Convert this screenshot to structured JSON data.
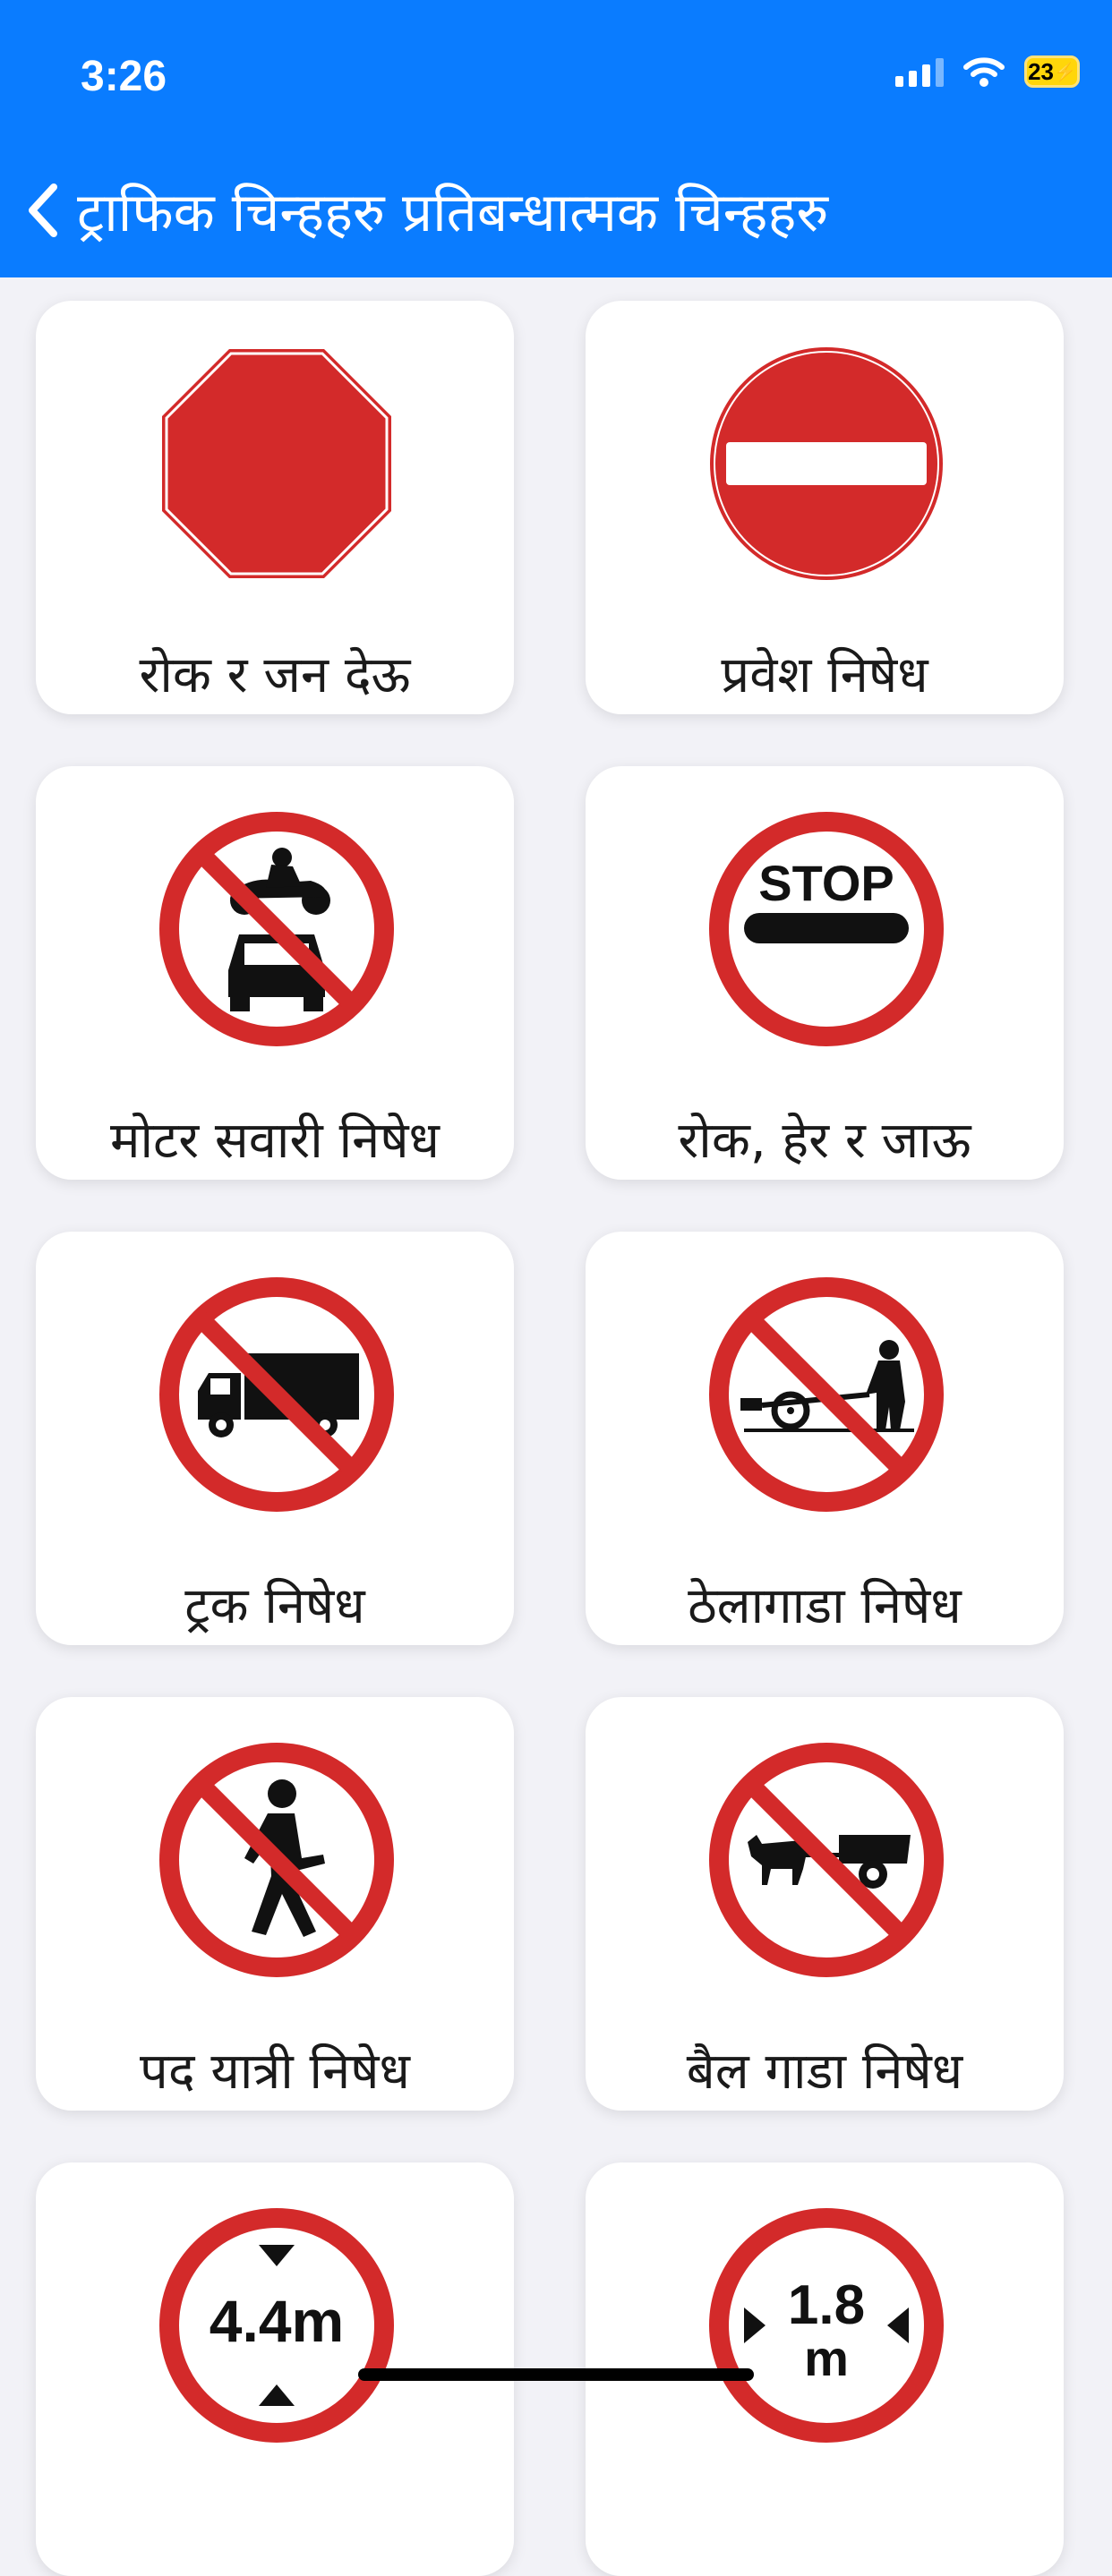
{
  "status": {
    "time": "3:26",
    "battery": "23"
  },
  "nav": {
    "title": "ट्राफिक चिन्हहरु प्रतिबन्धात्मक चिन्हहरु",
    "back_icon": "chevron-left-icon"
  },
  "signs": [
    {
      "label": "रोक र जन देऊ",
      "icon": "stop-octagon-icon"
    },
    {
      "label": "प्रवेश निषेध",
      "icon": "no-entry-icon"
    },
    {
      "label": "मोटर सवारी निषेध",
      "icon": "no-motor-vehicles-icon"
    },
    {
      "label": "रोक, हेर र जाऊ",
      "icon": "stop-look-go-icon",
      "sign_text": "STOP"
    },
    {
      "label": "ट्रक निषेध",
      "icon": "no-trucks-icon"
    },
    {
      "label": "ठेलागाडा निषेध",
      "icon": "no-handcarts-icon"
    },
    {
      "label": "पद यात्री निषेध",
      "icon": "no-pedestrians-icon"
    },
    {
      "label": "बैल गाडा निषेध",
      "icon": "no-bullock-carts-icon"
    },
    {
      "label": "",
      "icon": "height-limit-icon",
      "sign_text": "4.4m"
    },
    {
      "label": "",
      "icon": "width-limit-icon",
      "sign_text": "1.8 m"
    }
  ],
  "colors": {
    "header": "#0a7cff",
    "sign_red": "#d32a2a"
  }
}
